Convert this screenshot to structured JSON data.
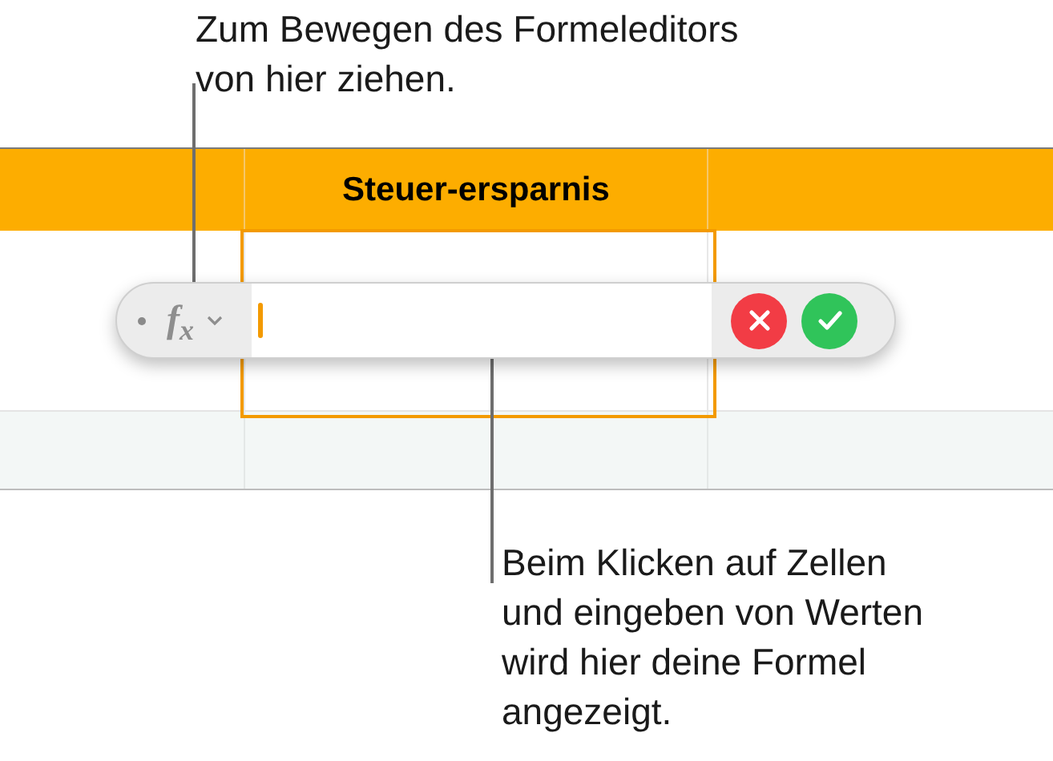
{
  "callouts": [
    {
      "kind": "top",
      "text": "Zum Bewegen des Formeleditors\nvon hier ziehen."
    },
    {
      "kind": "bottom",
      "text": "Beim Klicken auf Zellen\nund eingeben von Werten\nwird hier deine Formel\nangezeigt."
    }
  ],
  "table": {
    "header": "Steuer-ersparnis"
  },
  "formula_editor": {
    "symbol": "f$_{x}$"
  }
}
